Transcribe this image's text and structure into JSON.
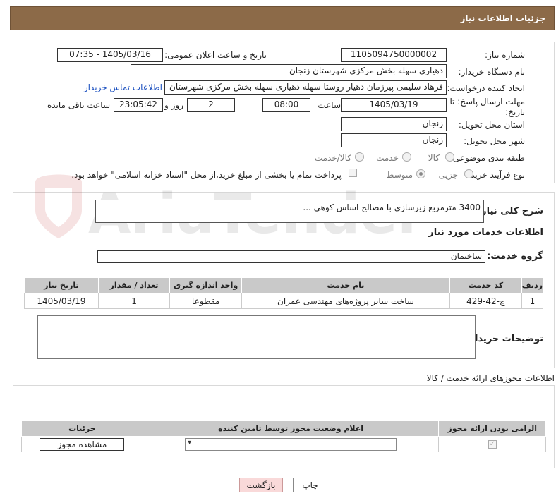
{
  "header": {
    "title": "جزئیات اطلاعات نیاز"
  },
  "form": {
    "need_number_label": "شماره نیاز:",
    "need_number": "1105094750000002",
    "announce_label": "تاریخ و ساعت اعلان عمومی:",
    "announce_value": "1405/03/16 - 07:35",
    "buyer_org_label": "نام دستگاه خریدار:",
    "buyer_org": "دهیاری سهله بخش مرکزی شهرستان زنجان",
    "creator_label": "ایجاد کننده درخواست:",
    "creator": "فرهاد سلیمی پیرزمان دهیار روستا سهله دهیاری سهله بخش مرکزی شهرستان",
    "contact_link": "اطلاعات تماس خریدار",
    "deadline_label_1": "مهلت ارسال پاسخ: تا",
    "deadline_label_2": "تاریخ:",
    "deadline_date": "1405/03/19",
    "time_label": "ساعت",
    "deadline_time": "08:00",
    "days_value": "2",
    "days_label": "روز و",
    "remaining_time": "23:05:42",
    "remaining_label": "ساعت باقی مانده",
    "province_label": "استان محل تحویل:",
    "province": "زنجان",
    "city_label": "شهر محل تحویل:",
    "city": "زنجان",
    "category_label": "طبقه بندی موضوعی:",
    "category_options": [
      "کالا",
      "خدمت",
      "کالا/خدمت"
    ],
    "process_label": "نوع فرآیند خرید :",
    "process_options": [
      "جزیی",
      "متوسط"
    ],
    "payment_note": "پرداخت تمام یا بخشی از مبلغ خرید،از محل \"اسناد خزانه اسلامی\" خواهد بود."
  },
  "description": {
    "label": "شرح کلی نیاز:",
    "value": "3400 مترمربع زیرسازی با مصالح اساس کوهی ..."
  },
  "services": {
    "title": "اطلاعات خدمات مورد نیاز",
    "group_label": "گروه خدمت:",
    "group_value": "ساختمان",
    "columns": [
      "ردیف",
      "کد خدمت",
      "نام خدمت",
      "واحد اندازه گیری",
      "تعداد / مقدار",
      "تاریخ نیاز"
    ],
    "rows": [
      [
        "1",
        "ج-42-429",
        "ساخت سایر پروژه‌های مهندسی عمران",
        "مقطوعا",
        "1",
        "1405/03/19"
      ]
    ],
    "buyer_notes_label": "توضیحات خریدار:"
  },
  "permits": {
    "title": "اطلاعات مجوزهای ارائه خدمت / کالا",
    "columns": [
      "الزامی بودن ارائه مجوز",
      "اعلام وضعیت مجوز توسط تامین کننده",
      "جزئیات"
    ],
    "select_value": "--",
    "view_button": "مشاهده مجوز"
  },
  "actions": {
    "print": "چاپ",
    "back": "بازگشت"
  },
  "watermark": {
    "text": "AriaTender.neT"
  }
}
